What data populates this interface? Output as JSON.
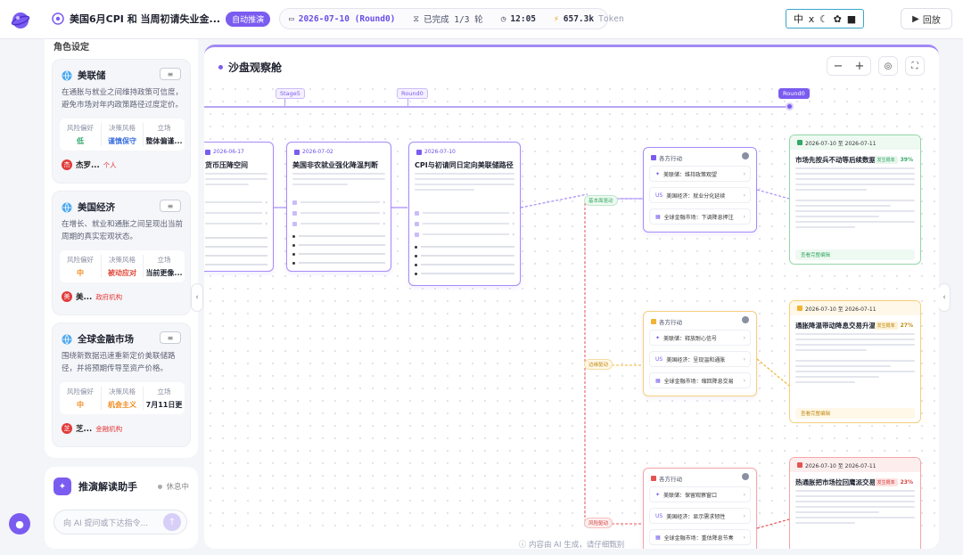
{
  "topbar": {
    "session_title": "美国6月CPI 和 当周初请失业金...",
    "auto_badge": "自动推演",
    "date_round": "2026-07-10 (Round0)",
    "progress": "已完成 1/3 轮",
    "time": "12:05",
    "tokens": "657.3k",
    "token_unit": "Token",
    "lang_label": "中",
    "replay_label": "回放"
  },
  "sidebar": {
    "header": "角色设定",
    "stat_labels": {
      "risk": "风险偏好",
      "decision": "决策风格",
      "stance": "立场"
    },
    "agents": [
      {
        "name": "美联储",
        "desc": "在通胀与就业之间维持政策可信度，避免市场对年内政策路径过度定价。",
        "risk": "低",
        "risk_color": "#2ea86a",
        "decision": "谨慎保守",
        "decision_color": "#3a6fe0",
        "stance": "整体偏谨...",
        "foot_name": "杰罗...",
        "foot_tag": "个人",
        "foot_initial": "杰"
      },
      {
        "name": "美国经济",
        "desc": "在增长、就业和通胀之间呈现出当前周期的真实宏观状态。",
        "risk": "中",
        "risk_color": "#f08a1c",
        "decision": "被动应对",
        "decision_color": "#e0483a",
        "stance": "当前更像...",
        "foot_name": "美...",
        "foot_tag": "政府机构",
        "foot_initial": "美"
      },
      {
        "name": "全球金融市场",
        "desc": "围绕新数据迅速重新定价美联储路径，并将预期传导至资产价格。",
        "risk": "中",
        "risk_color": "#f08a1c",
        "decision": "机会主义",
        "decision_color": "#f08a1c",
        "stance": "7月11日更",
        "foot_name": "芝...",
        "foot_tag": "金融机构",
        "foot_initial": "芝"
      }
    ]
  },
  "assistant": {
    "title": "推演解读助手",
    "status": "休息中",
    "placeholder": "向 AI 提问或下达指令..."
  },
  "main": {
    "title": "沙盘观察舱",
    "timeline": [
      "Stage5",
      "Round0",
      "Round0"
    ],
    "nodes": [
      {
        "date": "2026-06-17",
        "title": "货币压降空间"
      },
      {
        "date": "2026-07-02",
        "title": "美国非农就业强化降温判断"
      },
      {
        "date": "2026-07-10",
        "title": "CPI与初请同日定向美联储路径"
      }
    ],
    "groups": [
      {
        "title": "各方行动",
        "rows": [
          "美联储：维持政策观望",
          "美国经济：就业分化延续",
          "全球金融市场：下调降息押注"
        ]
      },
      {
        "title": "各方行动",
        "rows": [
          "美联储：释放耐心信号",
          "美国经济：呈现温和通胀",
          "全球金融市场：缩回降息交易"
        ]
      },
      {
        "title": "各方行动",
        "rows": [
          "美联储：保留观察窗口",
          "美国经济：显示需求韧性",
          "全球金融市场：重估降息节奏"
        ]
      }
    ],
    "edges": [
      "基本面驱动",
      "边缘驱动",
      "风险驱动"
    ],
    "results": [
      {
        "date": "2026-07-10 至 2026-07-11",
        "title": "市场先按兵不动等后续数据",
        "prob_label": "发生概率",
        "prob": "39%",
        "foot": "查看完整编辑"
      },
      {
        "date": "2026-07-10 至 2026-07-11",
        "title": "通胀降温带动降息交易升温",
        "prob_label": "发生概率",
        "prob": "27%",
        "foot": "查看完整编辑"
      },
      {
        "date": "2026-07-10 至 2026-07-11",
        "title": "热通胀把市场拉回鹰派交易",
        "prob_label": "发生概率",
        "prob": "23%",
        "foot": ""
      }
    ],
    "footer_note": "内容由 AI 生成，请仔细甄别"
  }
}
